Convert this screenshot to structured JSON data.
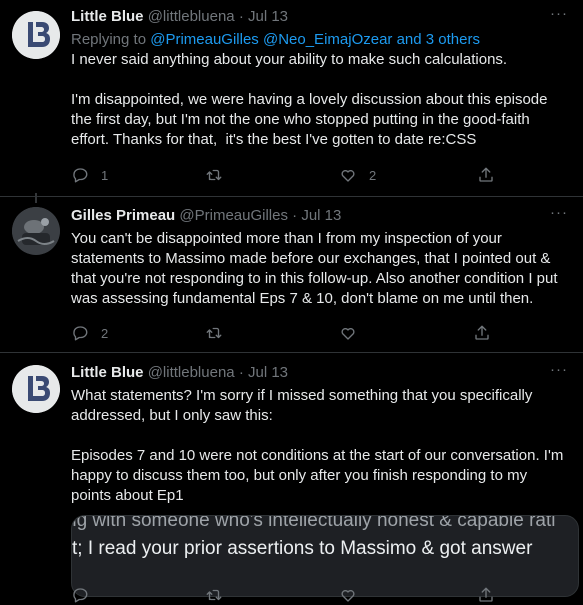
{
  "tweets": [
    {
      "name": "Little Blue",
      "handle": "@littlebluena",
      "sep": "·",
      "date": "Jul 13",
      "replying_prefix": "Replying to",
      "replying_mentions": "@PrimeauGilles @Neo_EimajOzear and 3 others",
      "text": "I never said anything about your ability to make such calculations.\n\nI'm disappointed, we were having a lovely discussion about this episode the first day, but I'm not the one who stopped putting in the good-faith effort. Thanks for that,  it's the best I've gotten to date re:CSS",
      "reply_count": "1",
      "retweet_count": "",
      "like_count": "2",
      "avatar_icon": "lb-logo-icon"
    },
    {
      "name": "Gilles Primeau",
      "handle": "@PrimeauGilles",
      "sep": "·",
      "date": "Jul 13",
      "text": "You can't be disappointed more than I from my inspection of your statements to Massimo made before our exchanges, that I pointed out & that you're not responding to in this follow-up. Also another condition I put was assessing fundamental Eps 7 & 10, don't blame on me until then.",
      "reply_count": "2",
      "retweet_count": "",
      "like_count": "",
      "avatar_icon": "profile-photo"
    },
    {
      "name": "Little Blue",
      "handle": "@littlebluena",
      "sep": "·",
      "date": "Jul 13",
      "text": "What statements? I'm sorry if I missed something that you specifically addressed, but I only saw this:\n\nEpisodes 7 and 10 were not conditions at the start of our conversation. I'm happy to discuss them too, but only after you finish responding to my points about Ep1",
      "quote_line1": "ng with someone who's intellectually honest & capable rati",
      "quote_line2": "t; I read your prior assertions to Massimo & got answer",
      "avatar_icon": "lb-logo-icon"
    }
  ],
  "more_label": "···",
  "icons": [
    "reply-icon",
    "retweet-icon",
    "like-icon",
    "share-icon",
    "more-icon"
  ],
  "colors": {
    "background": "#000000",
    "text": "#e7e9ea",
    "muted": "#71767b",
    "link": "#1d9bf0"
  }
}
